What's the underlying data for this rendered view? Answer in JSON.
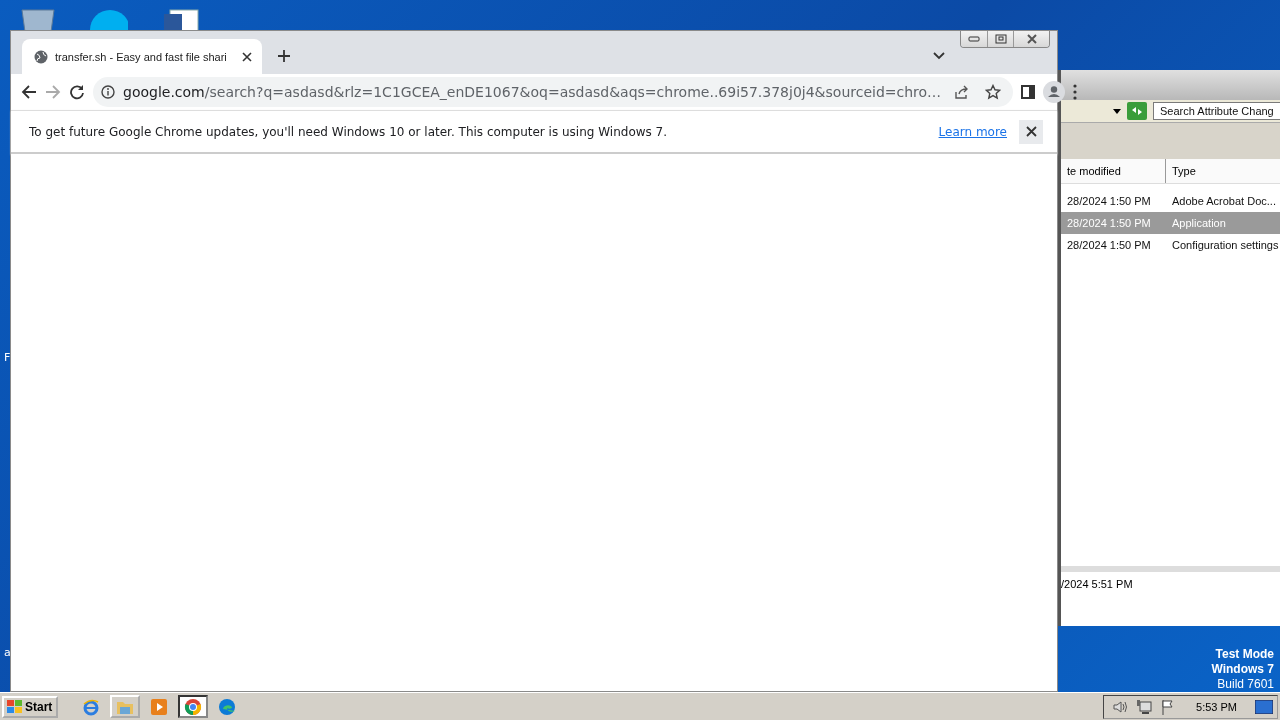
{
  "desktop": {
    "edge_labels": [
      "F",
      "a"
    ],
    "system_text": [
      "Test Mode",
      "Windows 7",
      "Build 7601"
    ]
  },
  "explorer": {
    "search": {
      "placeholder": "Search Attribute Chang"
    },
    "columns": [
      "te modified",
      "Type"
    ],
    "rows": [
      {
        "modified": "28/2024 1:50 PM",
        "type": "Adobe Acrobat Doc...",
        "selected": false
      },
      {
        "modified": "28/2024 1:50 PM",
        "type": "Application",
        "selected": true
      },
      {
        "modified": "28/2024 1:50 PM",
        "type": "Configuration settings",
        "selected": false
      }
    ],
    "details_date": "/2024 5:51 PM"
  },
  "chrome": {
    "tabs": [
      {
        "title": "transfer.sh - Easy and fast file shari",
        "selected": true
      }
    ],
    "address": {
      "host": "google.com",
      "path": "/search?q=asdasd&rlz=1C1GCEA_enDE1067&oq=asdasd&aqs=chrome..69i57.378j0j4&sourceid=chro…"
    },
    "infobar": {
      "message": "To get future Google Chrome updates, you'll need Windows 10 or later. This computer is using Windows 7.",
      "link": "Learn more"
    }
  },
  "taskbar": {
    "start": "Start",
    "apps": [
      {
        "kind": "ie",
        "running": false,
        "selected": false
      },
      {
        "kind": "folder",
        "running": true,
        "selected": false
      },
      {
        "kind": "media",
        "running": false,
        "selected": false
      },
      {
        "kind": "chrome",
        "running": true,
        "selected": true
      },
      {
        "kind": "edge",
        "running": false,
        "selected": false
      }
    ],
    "clock": "5:53 PM"
  }
}
